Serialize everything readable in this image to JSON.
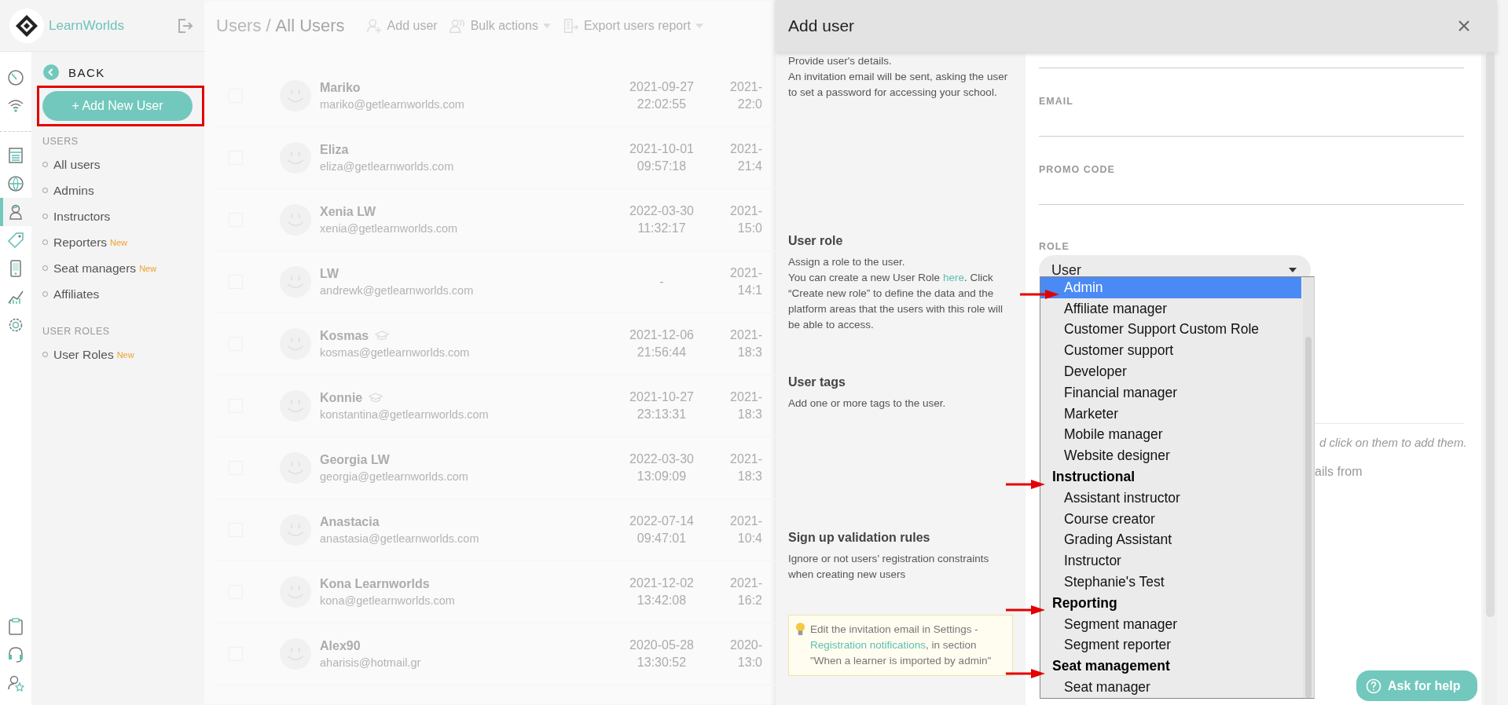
{
  "sidebar": {
    "brand": "LearnWorlds",
    "rail_items": [
      {
        "selected": false
      },
      {
        "selected": false
      },
      {
        "selected": false
      },
      {
        "selected": false
      },
      {
        "selected": true
      },
      {
        "selected": false
      },
      {
        "selected": false
      },
      {
        "selected": false
      },
      {
        "selected": false
      },
      {
        "selected": false
      },
      {
        "selected": false
      },
      {
        "selected": false
      }
    ],
    "back": "BACK",
    "add_button": "+ Add New User",
    "sections": [
      {
        "title": "USERS",
        "items": [
          {
            "label": "All users"
          },
          {
            "label": "Admins"
          },
          {
            "label": "Instructors"
          },
          {
            "label": "Reporters",
            "badge": "New"
          },
          {
            "label": "Seat managers",
            "badge": "New"
          },
          {
            "label": "Affiliates"
          }
        ]
      },
      {
        "title": "USER ROLES",
        "items": [
          {
            "label": "User Roles",
            "badge": "New"
          }
        ]
      }
    ]
  },
  "main": {
    "breadcrumb": {
      "parent": "Users",
      "separator": "/",
      "current": "All Users"
    },
    "toolbar": [
      {
        "label": "Add user",
        "dropdown": false
      },
      {
        "label": "Bulk actions",
        "dropdown": true
      },
      {
        "label": "Export users report",
        "dropdown": true
      }
    ],
    "rows": [
      {
        "checked": false,
        "name": "Mariko",
        "instructor": false,
        "email": "mariko@getlearnworlds.com",
        "date": "2021-09-27",
        "time": "22:02:55",
        "column_3_date": "2021-",
        "column_3_time": "22:0"
      },
      {
        "checked": false,
        "name": "Eliza",
        "instructor": false,
        "email": "eliza@getlearnworlds.com",
        "date": "2021-10-01",
        "time": "09:57:18",
        "column_3_date": "2021-",
        "column_3_time": "21:4"
      },
      {
        "checked": false,
        "name": "Xenia LW",
        "instructor": false,
        "email": "xenia@getlearnworlds.com",
        "date": "2022-03-30",
        "time": "11:32:17",
        "column_3_date": "2021-",
        "column_3_time": "15:0"
      },
      {
        "checked": false,
        "name": "LW",
        "instructor": false,
        "email": "andrewk@getlearnworlds.com",
        "date": "-",
        "column_3_date": "2021-",
        "column_3_time": "14:1"
      },
      {
        "checked": false,
        "name": "Kosmas",
        "instructor": true,
        "email": "kosmas@getlearnworlds.com",
        "date": "2021-12-06",
        "time": "21:56:44",
        "column_3_date": "2021-",
        "column_3_time": "18:3"
      },
      {
        "checked": false,
        "name": "Konnie",
        "instructor": true,
        "email": "konstantina@getlearnworlds.com",
        "date": "2021-10-27",
        "time": "23:13:31",
        "column_3_date": "2021-",
        "column_3_time": "18:3"
      },
      {
        "checked": false,
        "name": "Georgia LW",
        "instructor": false,
        "email": "georgia@getlearnworlds.com",
        "date": "2022-03-30",
        "time": "13:09:09",
        "column_3_date": "2021-",
        "column_3_time": "18:3"
      },
      {
        "checked": false,
        "name": "Anastacia",
        "instructor": false,
        "email": "anastasia@getlearnworlds.com",
        "date": "2022-07-14",
        "time": "09:47:01",
        "column_3_date": "2021-",
        "column_3_time": "10:4"
      },
      {
        "checked": false,
        "name": "Kona Learnworlds",
        "instructor": false,
        "email": "kona@getlearnworlds.com",
        "date": "2021-12-02",
        "time": "13:42:08",
        "column_3_date": "2021-",
        "column_3_time": "16:2"
      },
      {
        "checked": false,
        "name": "Alex90",
        "instructor": false,
        "email": "aharisis@hotmail.gr",
        "date": "2020-05-28",
        "time": "13:30:52",
        "column_3_date": "2020-",
        "column_3_time": "13:0"
      }
    ]
  },
  "drawer": {
    "title": "Add user",
    "intro": [
      "Provide user's details.",
      "An invitation email will be sent, asking the user to set a password for accessing your school."
    ],
    "sections": [
      {
        "title": "User role",
        "paragraphs": [
          {
            "text": "Assign a role to the user."
          },
          {
            "before": "You can create a new User Role ",
            "link": "here",
            "after": ". Click “Create new role” to define the data and the platform areas that the users with this role will be able to access."
          }
        ]
      },
      {
        "title": "User tags",
        "paragraphs": [
          {
            "text": "Add one or more tags to the user."
          }
        ]
      },
      {
        "title": "Sign up validation rules",
        "paragraphs": [
          {
            "text": "Ignore or not users’ registration constraints when creating new users"
          }
        ]
      }
    ],
    "note": {
      "before": "Edit the invitation email in Settings - ",
      "link": "Registration notifications",
      "after": ", in section \"When a learner is imported by admin\""
    },
    "fields": [
      {
        "label": "EMAIL"
      },
      {
        "label": "PROMO CODE"
      }
    ],
    "role": {
      "label": "ROLE",
      "value": "User",
      "open": true
    },
    "options": [
      {
        "kind": "option",
        "label": "Admin",
        "selected": true,
        "annotated": true
      },
      {
        "kind": "option",
        "label": "Affiliate manager",
        "selected": false
      },
      {
        "kind": "option",
        "label": "Customer Support Custom Role",
        "selected": false
      },
      {
        "kind": "option",
        "label": "Customer support",
        "selected": false
      },
      {
        "kind": "option",
        "label": "Developer",
        "selected": false
      },
      {
        "kind": "option",
        "label": "Financial manager",
        "selected": false
      },
      {
        "kind": "option",
        "label": "Marketer",
        "selected": false
      },
      {
        "kind": "option",
        "label": "Mobile manager",
        "selected": false
      },
      {
        "kind": "option",
        "label": "Website designer",
        "selected": false
      },
      {
        "kind": "group",
        "label": "Instructional",
        "annotated": true
      },
      {
        "kind": "option",
        "label": "Assistant instructor",
        "selected": false
      },
      {
        "kind": "option",
        "label": "Course creator",
        "selected": false
      },
      {
        "kind": "option",
        "label": "Grading Assistant",
        "selected": false
      },
      {
        "kind": "option",
        "label": "Instructor",
        "selected": false
      },
      {
        "kind": "option",
        "label": "Stephanie's Test",
        "selected": false
      },
      {
        "kind": "group",
        "label": "Reporting",
        "annotated": true
      },
      {
        "kind": "option",
        "label": "Segment manager",
        "selected": false
      },
      {
        "kind": "option",
        "label": "Segment reporter",
        "selected": false
      },
      {
        "kind": "group",
        "label": "Seat management",
        "annotated": true
      },
      {
        "kind": "option",
        "label": "Seat manager",
        "selected": false
      }
    ],
    "hidden_hint": "d click on them to add them.",
    "hidden_text": "ails from",
    "help_button": "Ask for help"
  }
}
